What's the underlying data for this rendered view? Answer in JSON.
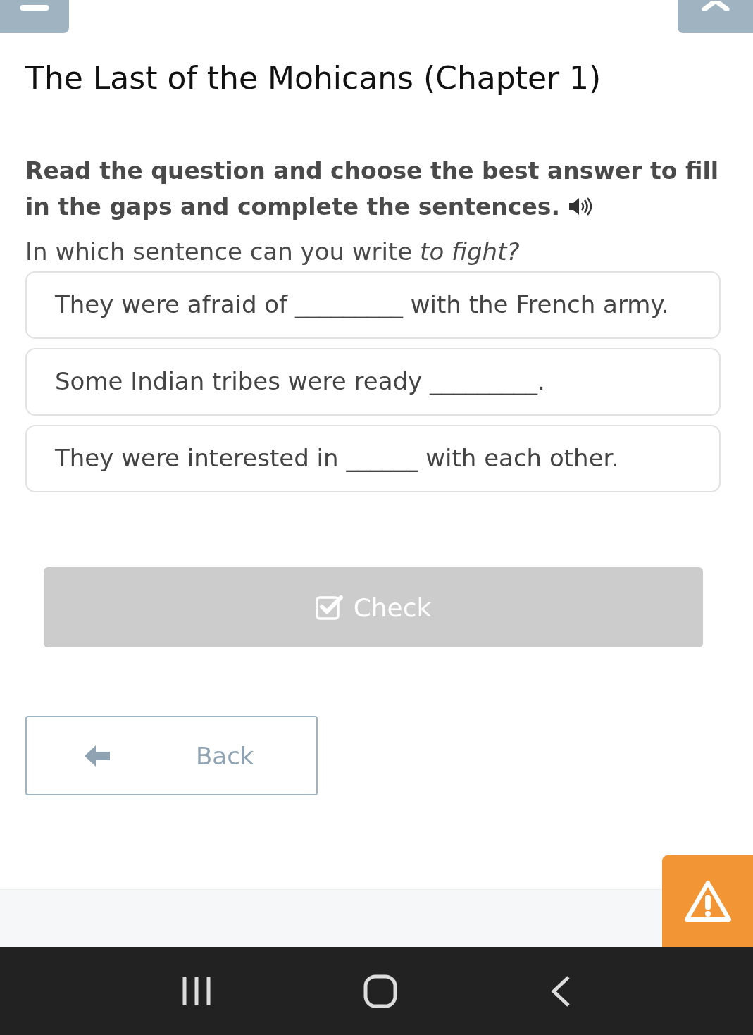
{
  "title": "The Last of the Mohicans (Chapter 1)",
  "instruction": "Read the question and choose the best answer to fill in the gaps and complete the sentences.",
  "question": "In which sentence can you write *to fight?*",
  "options": [
    {
      "text": "They were afraid of _________ with the French army.",
      "selected": false
    },
    {
      "text": "Some Indian tribes were ready _________.",
      "selected": false
    },
    {
      "text": "They were interested in ______ with each other.",
      "selected": false
    }
  ],
  "check_button": {
    "label": "Check",
    "disabled": true
  },
  "back_button": {
    "label": "Back"
  }
}
